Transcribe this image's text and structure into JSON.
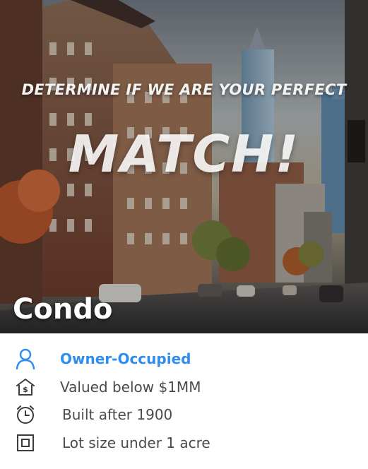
{
  "hero": {
    "headline_small": "DETERMINE IF WE ARE YOUR PERFECT",
    "headline_big": "MATCH!",
    "property_type": "Condo"
  },
  "features": [
    {
      "icon": "person-icon",
      "label": "Owner-Occupied",
      "highlighted": true
    },
    {
      "icon": "house-dollar-icon",
      "label": "Valued below $1MM",
      "highlighted": false
    },
    {
      "icon": "alarm-clock-icon",
      "label": "Built after 1900",
      "highlighted": false
    },
    {
      "icon": "lot-size-icon",
      "label": "Lot size under 1 acre",
      "highlighted": false
    }
  ],
  "colors": {
    "accent": "#2f8df0",
    "text": "#4a4a4a",
    "icon": "#3b3b3b"
  }
}
